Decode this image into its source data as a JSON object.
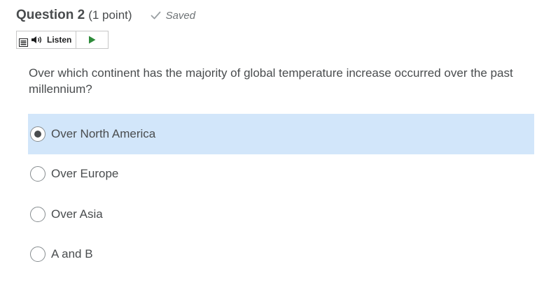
{
  "question": {
    "title": "Question 2",
    "points": "(1 point)",
    "status": "Saved",
    "status_icon": "checkmark-icon",
    "text": "Over which continent has the majority of global temperature increase occurred over the past millennium?"
  },
  "toolbar": {
    "menu_icon": "menu-icon",
    "speaker_icon": "speaker-icon",
    "listen_label": "Listen",
    "play_icon": "play-icon",
    "play_color": "#2e8b3a"
  },
  "answers": {
    "options": [
      {
        "label": "Over North America",
        "selected": true
      },
      {
        "label": "Over Europe",
        "selected": false
      },
      {
        "label": "Over Asia",
        "selected": false
      },
      {
        "label": "A and B",
        "selected": false
      }
    ],
    "selected_background": "#d2e6fa"
  }
}
